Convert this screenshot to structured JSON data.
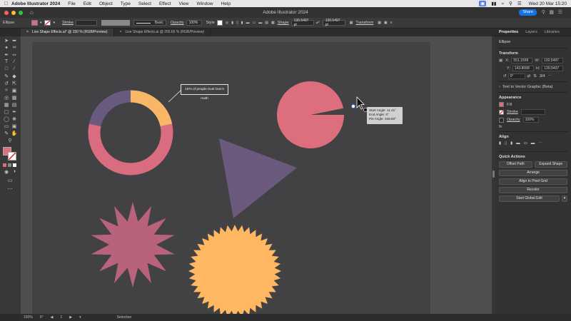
{
  "menubar": {
    "app_name": "Adobe Illustrator 2024",
    "items": [
      "File",
      "Edit",
      "Object",
      "Type",
      "Select",
      "Effect",
      "View",
      "Window",
      "Help"
    ],
    "clock": "Wed 20 Mar 15:20"
  },
  "window": {
    "title": "Adobe Illustrator 2024",
    "share_label": "Share"
  },
  "control_bar": {
    "selection_type": "Ellipse",
    "stroke_label": "Stroke",
    "brush_label": "Basic",
    "opacity_label": "Opacity",
    "opacity_value": "100%",
    "style_label": "Style",
    "shape_label": "Shape",
    "width_value": "130.5497 pt",
    "height_value": "130.5497 pt",
    "transform_label": "Transform"
  },
  "tabs": [
    {
      "label": "Live Shape Effects.ai* @ 150 % (RGB/Preview)",
      "active": true
    },
    {
      "label": "Live Shape Effects.ai @ 265.65 % (RGB/Preview)",
      "active": false
    }
  ],
  "panel": {
    "tabs": [
      "Properties",
      "Layers",
      "Libraries"
    ],
    "object_type": "Ellipse",
    "transform": {
      "title": "Transform",
      "x_label": "X:",
      "x": "551.1599",
      "y_label": "Y:",
      "y": "143.8068",
      "w_label": "W:",
      "w": "130.5497",
      "h_label": "H:",
      "h": "130.5497",
      "angle": "0°",
      "pie_value": "3/4"
    },
    "text_vector": "Text to Vector Graphic (Beta)",
    "appearance": {
      "title": "Appearance",
      "fill_label": "Fill",
      "stroke_label": "Stroke",
      "opacity_label": "Opacity",
      "opacity_value": "100%"
    },
    "align_title": "Align",
    "quick_actions": {
      "title": "Quick Actions",
      "offset_path": "Offset Path",
      "expand_shape": "Expand Shape",
      "arrange": "Arrange",
      "align_pixel": "Align to Pixel Grid",
      "recolor": "Recolor",
      "start_edit": "Start Global Edit"
    }
  },
  "canvas": {
    "callout_text": "15% of people trust Dan's math",
    "tooltip": {
      "line1": "Start Angle: 11.41°",
      "line2": "End Angle: 0°",
      "line3": "Pie Angle: 348.59°"
    }
  },
  "status": {
    "zoom": "150%",
    "rotation": "0°",
    "artboard_num": "1",
    "tool": "Selection"
  },
  "colors": {
    "donut_purple": "#6a5a7f",
    "donut_orange": "#f7b766",
    "donut_pink": "#d96c7e",
    "pie_pink": "#dd6e7e",
    "triangle_purple": "#6b5a7e",
    "star_mauve": "#b9627c",
    "sun_orange": "#ffb861",
    "artboard": "#424143"
  }
}
